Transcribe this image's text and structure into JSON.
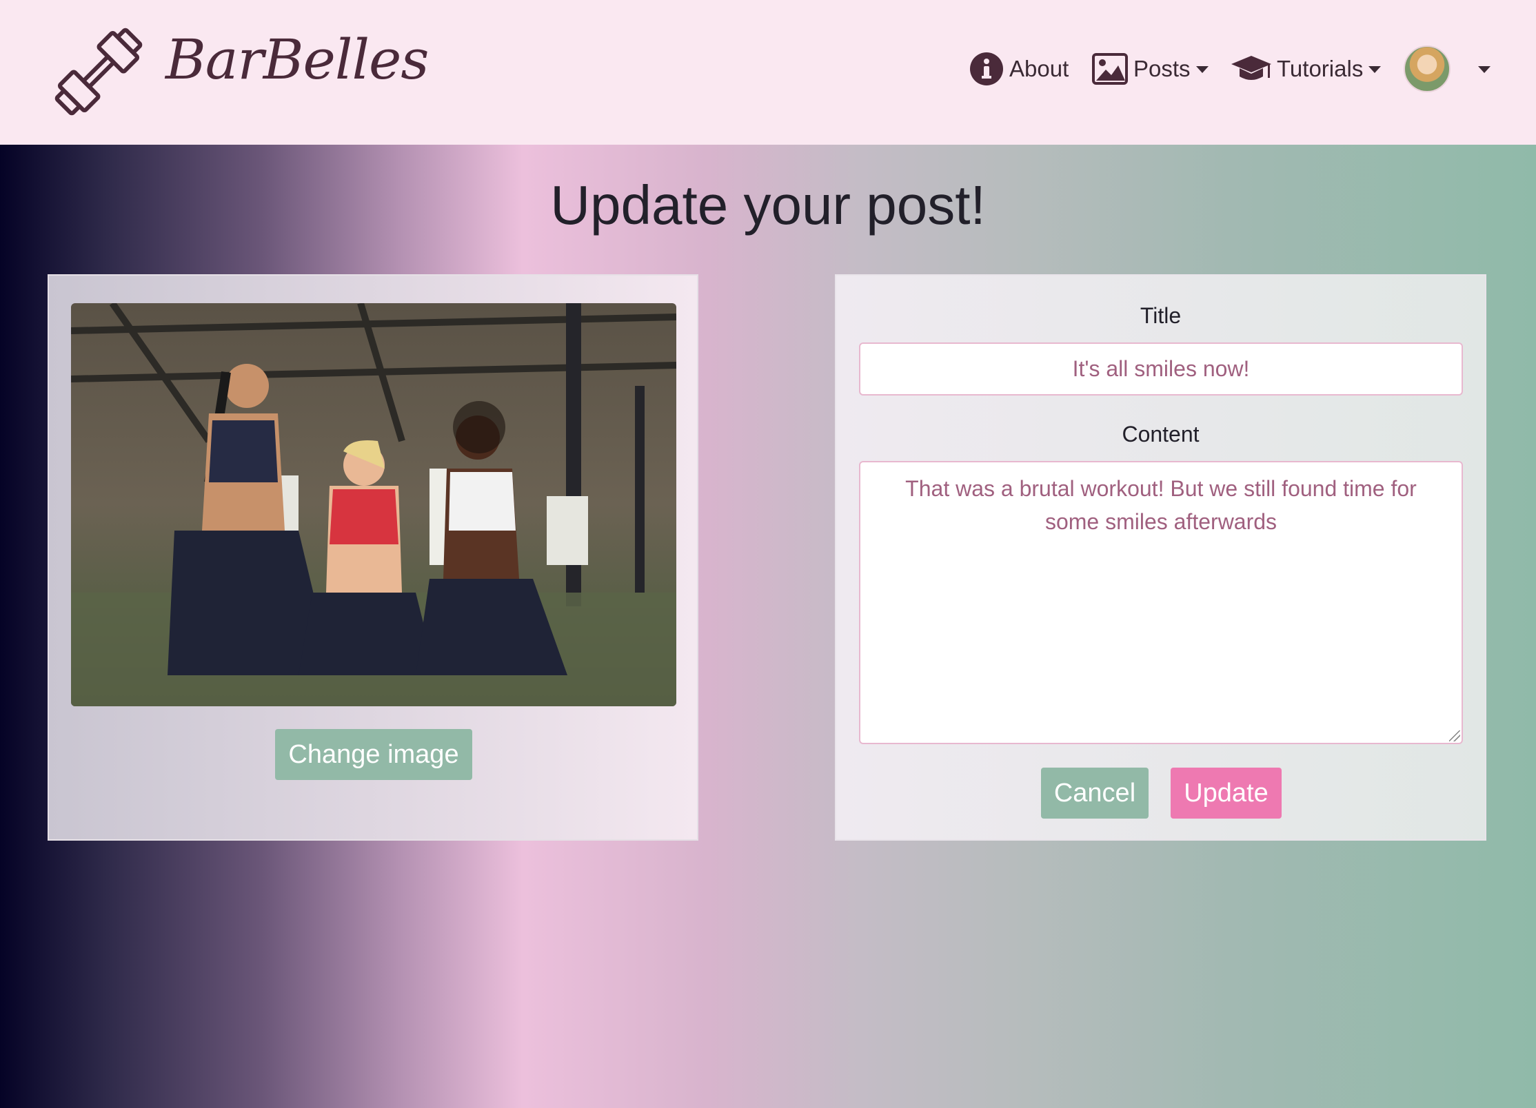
{
  "navbar": {
    "brand": "BarBelles",
    "about_label": "About",
    "posts_label": "Posts",
    "tutorials_label": "Tutorials"
  },
  "page": {
    "title": "Update your post!"
  },
  "image_card": {
    "change_image_label": "Change image"
  },
  "form": {
    "title_label": "Title",
    "title_value": "It's all smiles now!",
    "content_label": "Content",
    "content_value": "That was a brutal workout! But we still found time for some smiles afterwards",
    "cancel_label": "Cancel",
    "update_label": "Update"
  },
  "colors": {
    "navbar_bg": "#fae8f1",
    "brand_text": "#4a2a3a",
    "input_text": "#a0607f",
    "green_button": "#92b9a7",
    "pink_button": "#ee79b1"
  }
}
